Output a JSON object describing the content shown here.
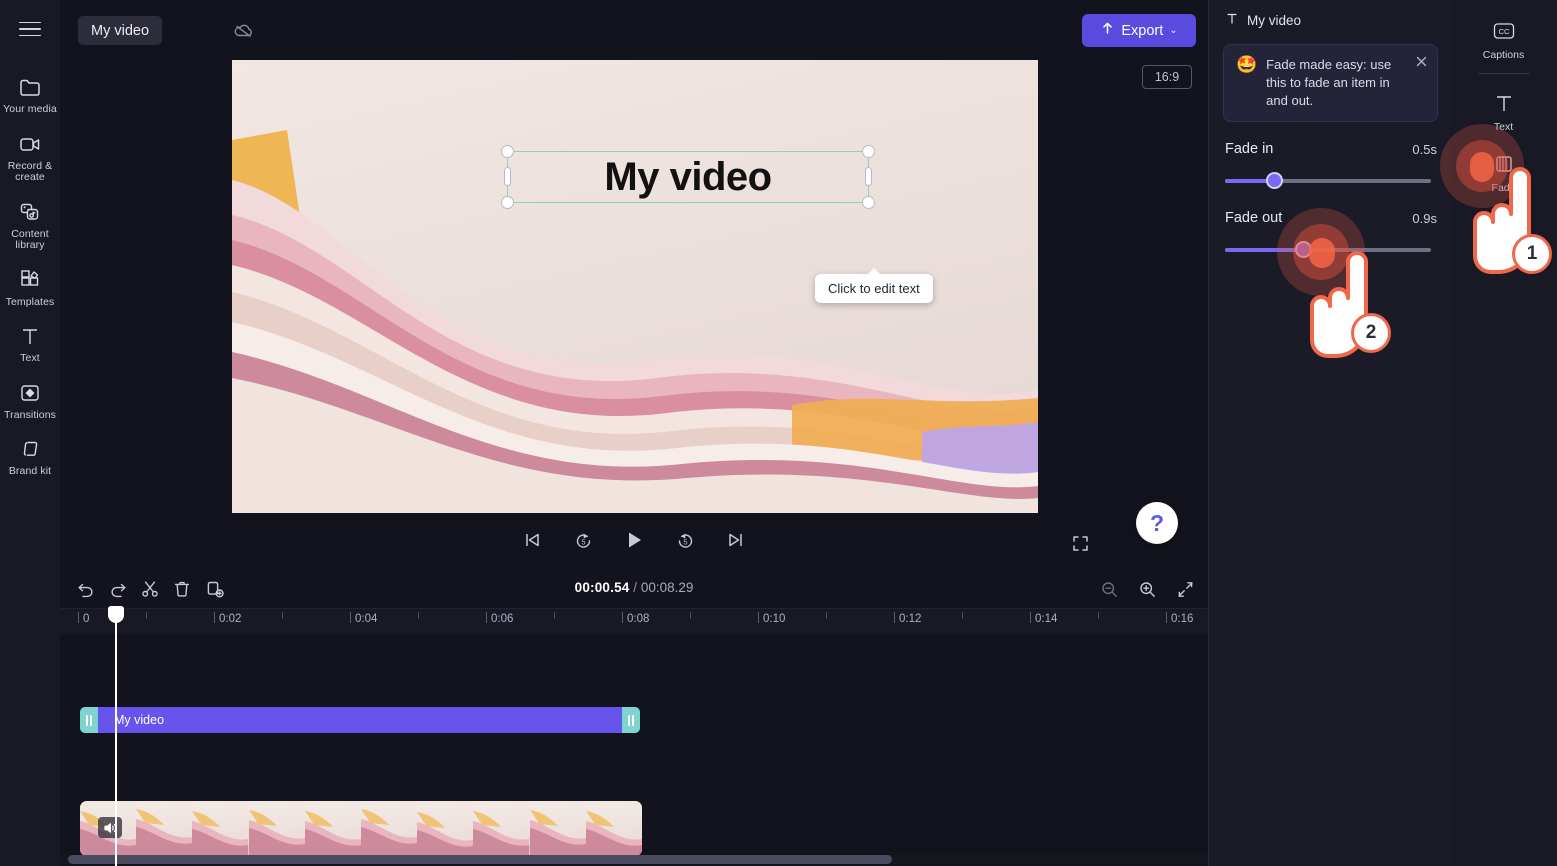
{
  "sidebar": {
    "menu_icon": "hamburger-icon",
    "items": [
      {
        "label": "Your media",
        "icon": "folder-icon"
      },
      {
        "label": "Record & create",
        "icon": "video-camera-icon"
      },
      {
        "label": "Content library",
        "icon": "media-library-icon"
      },
      {
        "label": "Templates",
        "icon": "templates-icon"
      },
      {
        "label": "Text",
        "icon": "text-t-icon"
      },
      {
        "label": "Transitions",
        "icon": "transitions-icon"
      },
      {
        "label": "Brand kit",
        "icon": "brand-kit-icon"
      }
    ],
    "expand_chevron": "›"
  },
  "topbar": {
    "project_title": "My video",
    "cloud_icon": "cloud-off-icon",
    "export_label": "Export",
    "export_icon": "upload-arrow-icon",
    "export_chevron": "⌄",
    "export_color": "#5b4ae0"
  },
  "stage": {
    "aspect_ratio": "16:9",
    "canvas_text": "My video",
    "edit_tooltip": "Click to edit text",
    "selection_color": "#8fd4b0",
    "controls": {
      "skip_start": "skip-to-start-icon",
      "back5": "rewind-5s-icon",
      "play": "play-icon",
      "forward5": "forward-5s-icon",
      "skip_end": "skip-to-end-icon",
      "fullscreen": "fullscreen-icon"
    },
    "help_label": "?",
    "collapse_chevron": "⌄"
  },
  "timeline": {
    "tools": [
      {
        "name": "undo",
        "glyph": "undo-icon"
      },
      {
        "name": "redo",
        "glyph": "redo-icon"
      },
      {
        "name": "split",
        "glyph": "scissors-icon"
      },
      {
        "name": "delete",
        "glyph": "trash-icon"
      },
      {
        "name": "duplicate",
        "glyph": "duplicate-icon"
      }
    ],
    "current_time": "00:00.54",
    "separator": "/",
    "total_time": "00:08.29",
    "ruler_ticks": [
      "0",
      "0:02",
      "0:04",
      "0:06",
      "0:08",
      "0:10",
      "0:12",
      "0:14",
      "0:16"
    ],
    "text_clip_label": "My video",
    "text_clip_color": "#6654ec",
    "trim_handle_color": "#7fd4cf",
    "mute_icon": "speaker-muted-icon",
    "zoom_out_icon": "zoom-out-icon",
    "zoom_in_icon": "zoom-in-icon",
    "fit_icon": "fit-to-screen-icon"
  },
  "right_panel": {
    "header_title": "My video",
    "header_icon": "text-t-icon",
    "tip": {
      "emoji": "🤩",
      "text": "Fade made easy: use this to fade an item in and out.",
      "close_icon": "close-icon"
    },
    "fade_in": {
      "label": "Fade in",
      "value": "0.5s",
      "percent": 24
    },
    "fade_out": {
      "label": "Fade out",
      "value": "0.9s",
      "percent": 38
    },
    "slider_color": "#7a68f0"
  },
  "rail": {
    "items": [
      {
        "label": "Captions",
        "icon": "cc-icon"
      },
      {
        "label": "Text",
        "icon": "text-t-icon"
      },
      {
        "label": "Fade",
        "icon": "fade-icon"
      }
    ]
  },
  "annotations": {
    "click1": "1",
    "click2": "2",
    "accent_color": "#f0674a"
  }
}
